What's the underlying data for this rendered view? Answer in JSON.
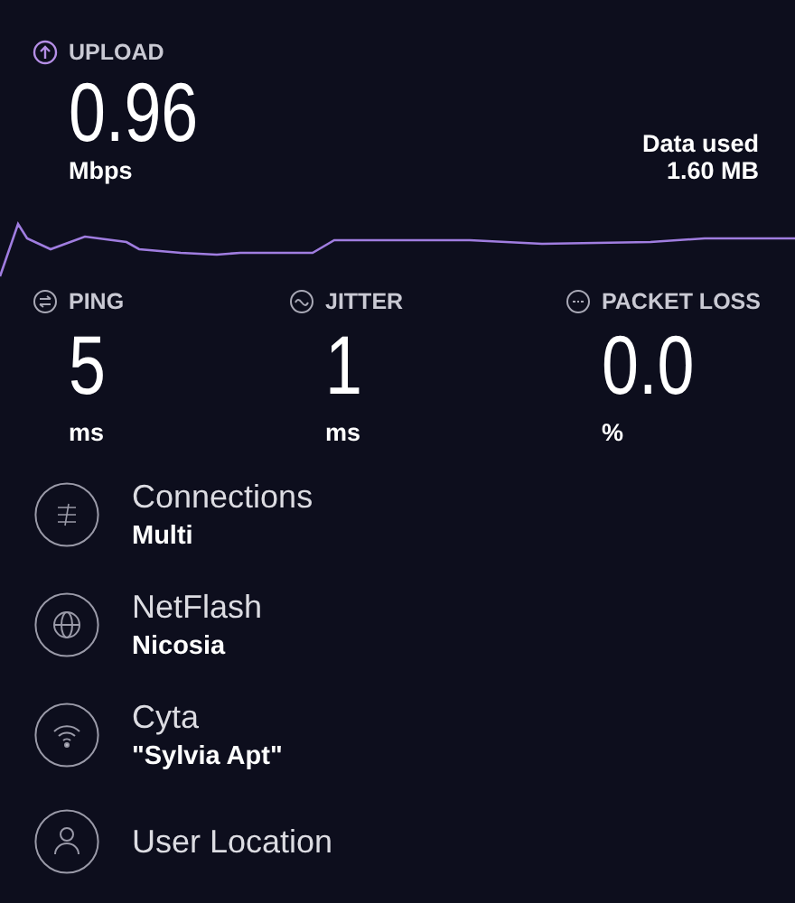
{
  "upload": {
    "label": "UPLOAD",
    "value": "0.96",
    "unit": "Mbps"
  },
  "data_used": {
    "label": "Data used",
    "value": "1.60 MB"
  },
  "metrics": [
    {
      "kind": "ping",
      "label": "PING",
      "value": "5",
      "unit": "ms"
    },
    {
      "kind": "jitter",
      "label": "JITTER",
      "value": "1",
      "unit": "ms"
    },
    {
      "kind": "loss",
      "label": "PACKET LOSS",
      "value": "0.0",
      "unit": "%"
    }
  ],
  "details": [
    {
      "kind": "connections",
      "title": "Connections",
      "value": "Multi"
    },
    {
      "kind": "server",
      "title": "NetFlash",
      "value": "Nicosia"
    },
    {
      "kind": "wifi",
      "title": "Cyta",
      "value": "\"Sylvia Apt\""
    },
    {
      "kind": "user",
      "title": "User Location"
    }
  ]
}
